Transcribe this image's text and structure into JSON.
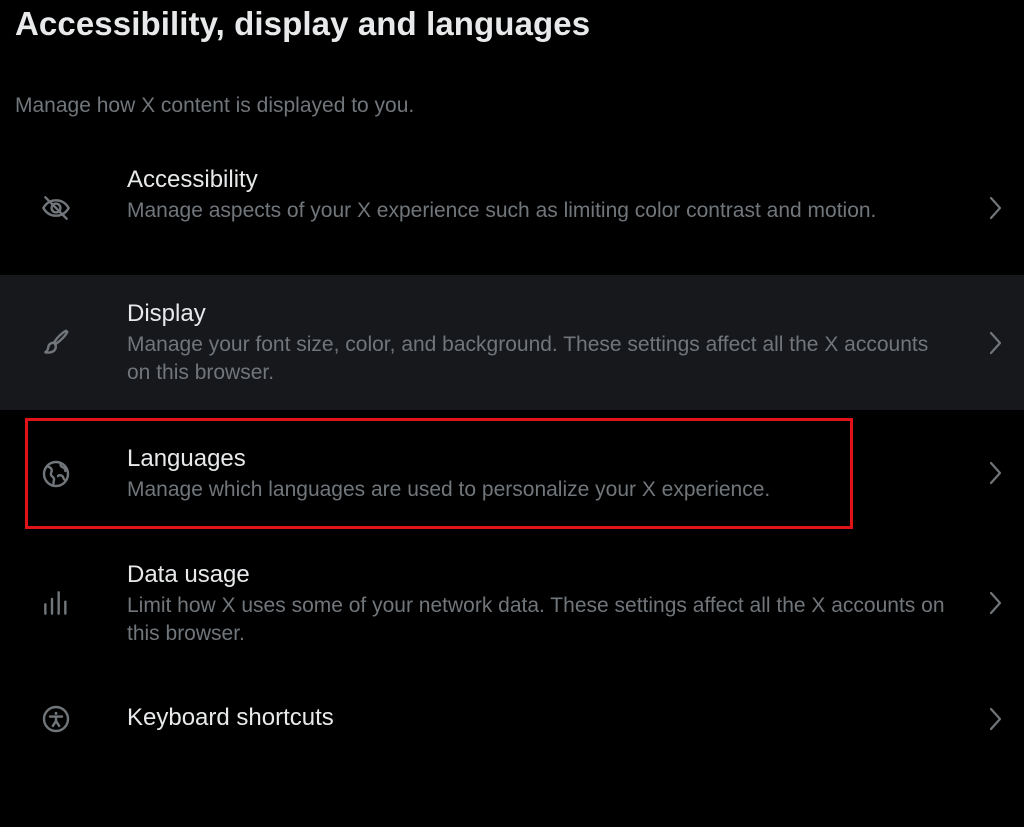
{
  "page": {
    "title": "Accessibility, display and languages",
    "subtitle": "Manage how X content is displayed to you."
  },
  "items": [
    {
      "title": "Accessibility",
      "description": "Manage aspects of your X experience such as limiting color contrast and motion.",
      "icon": "eye-slash-icon"
    },
    {
      "title": "Display",
      "description": "Manage your font size, color, and background. These settings affect all the X accounts on this browser.",
      "icon": "paintbrush-icon",
      "hovered": true
    },
    {
      "title": "Languages",
      "description": "Manage which languages are used to personalize your X experience.",
      "icon": "globe-icon",
      "highlighted": true
    },
    {
      "title": "Data usage",
      "description": "Limit how X uses some of your network data. These settings affect all the X accounts on this browser.",
      "icon": "bar-chart-icon"
    },
    {
      "title": "Keyboard shortcuts",
      "description": "",
      "icon": "accessibility-person-icon"
    }
  ],
  "colors": {
    "background": "#000000",
    "hover_row": "#16181c",
    "primary_text": "#e7e9ea",
    "secondary_text": "#71767b",
    "highlight_border": "#e0131a"
  }
}
